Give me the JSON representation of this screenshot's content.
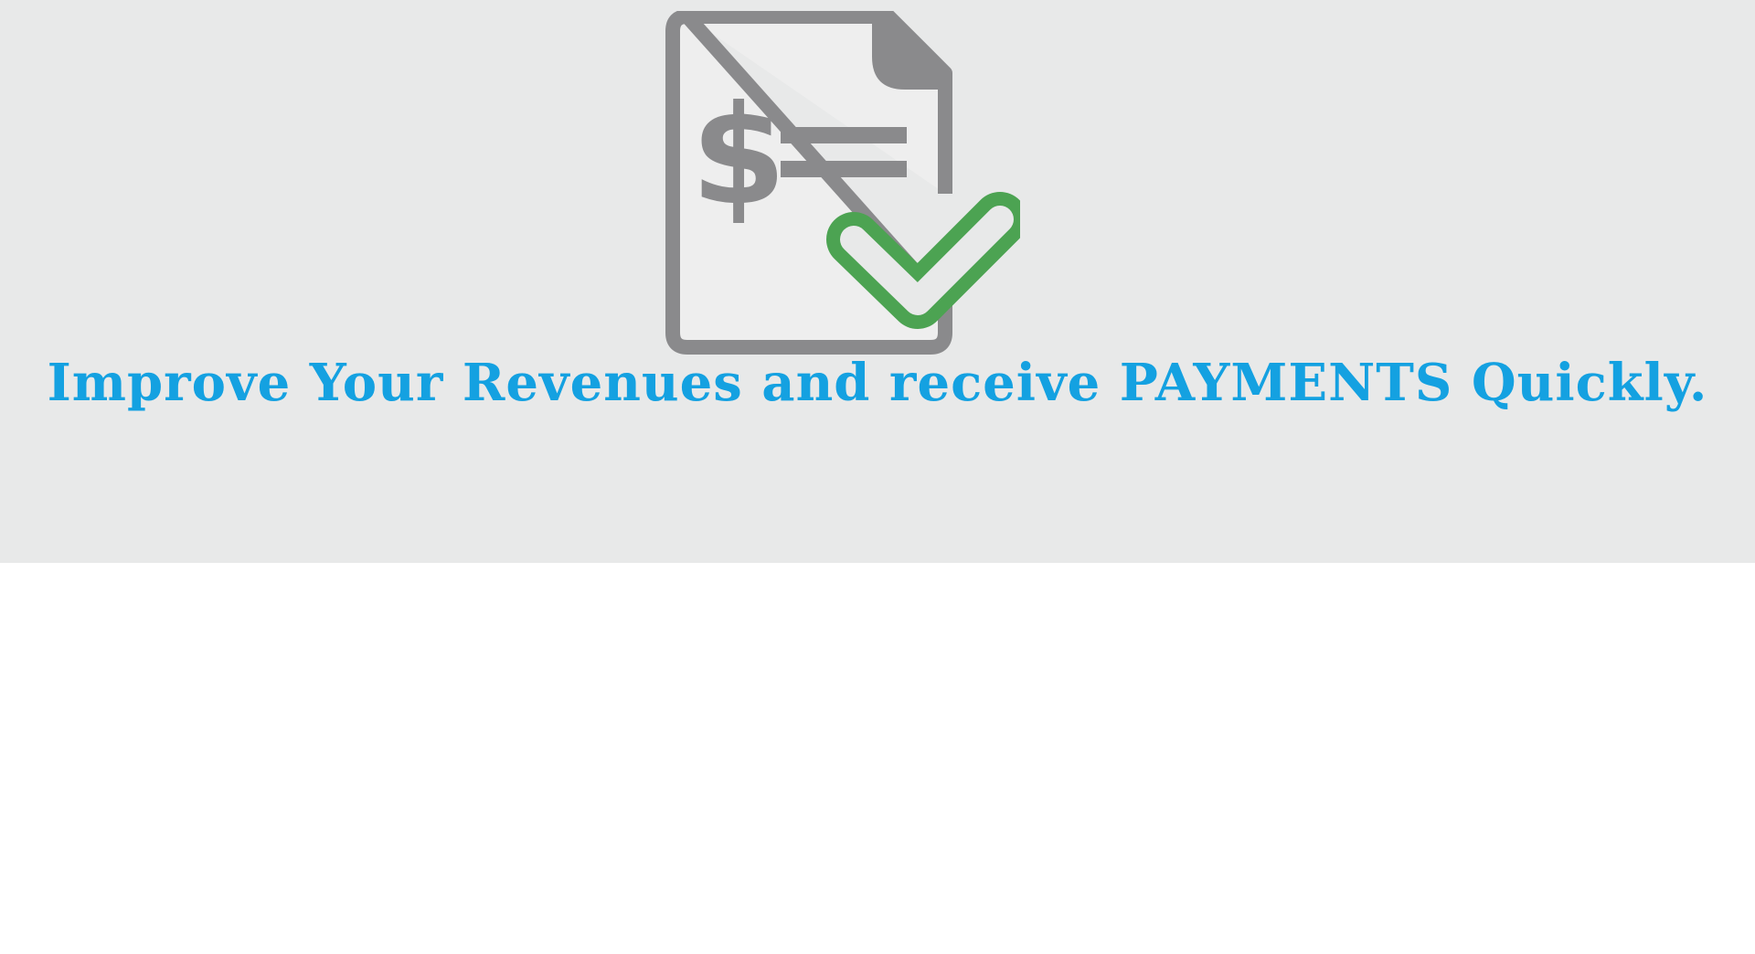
{
  "hero": {
    "headline": "Improve Your Revenues and receive PAYMENTS Quickly.",
    "background_color": "#e8e9e9",
    "headline_color": "#14a1e1",
    "icon": {
      "name": "invoice-paid-icon",
      "glyph": "$",
      "document_color": "#8a8a8c",
      "check_color": "#4ca352"
    }
  },
  "lower": {
    "background_color": "#ffffff"
  }
}
